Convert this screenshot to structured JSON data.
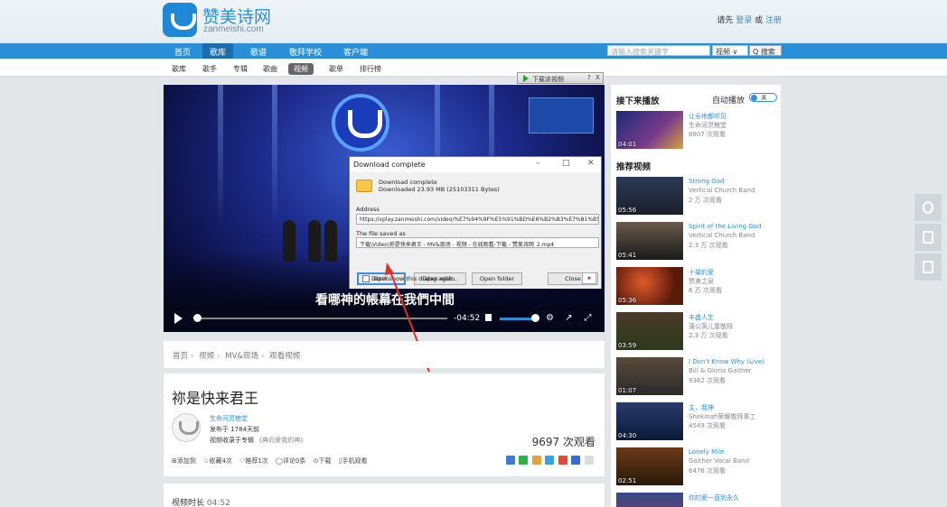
{
  "site": {
    "name": "赞美诗网",
    "domain": "zanmeishi.com"
  },
  "auth": {
    "prefix": "请先",
    "login": "登录",
    "or": "或",
    "register": "注册"
  },
  "nav": {
    "items": [
      "首页",
      "歌库",
      "歌谱",
      "敬拜学校",
      "客户端"
    ]
  },
  "search": {
    "placeholder": "请输入搜索关键字",
    "scope": "视频 ∨",
    "button": "Q 搜索"
  },
  "subnav": {
    "items": [
      "歌库",
      "歌手",
      "专辑",
      "歌曲",
      "视频",
      "歌单",
      "排行榜"
    ]
  },
  "download_bar": {
    "label": "下载该视频",
    "help": "?",
    "close": "X"
  },
  "video": {
    "subtitle": "看哪神的帳幕在我們中間",
    "time_remaining": "-04:52",
    "progress": 0.01,
    "volume": 0.85
  },
  "dialog": {
    "title": "Download complete",
    "minimize": "–",
    "maximize": "□",
    "close": "✕",
    "line1": "Download complete",
    "line2": "Downloaded 23.93  MB (25103311 Bytes)",
    "address_label": "Address",
    "address_value": "https://vplay.zanmeishi.com/video/%E7%94%9F%E5%91%BD%E6%B2%B3%E7%81%B5",
    "saved_label": "The file saved as",
    "saved_value": "下载\\Video\\祢是快来君王 - MV&现场 - 视频 - 在线观看-下载 - 赞美诗网_2.mp4",
    "btn_open": "Open",
    "btn_open_with": "Open with...",
    "btn_open_folder": "Open folder",
    "btn_close": "Close",
    "checkbox_label": "Don't show this dialog again"
  },
  "breadcrumb": {
    "items": [
      "首页",
      "视频",
      "MV&现场",
      "观看视频"
    ]
  },
  "info": {
    "title": "祢是快来君王",
    "uploader": "生命河灵粮堂",
    "published": "发布于 1784天前",
    "album_prefix": "视频收录于专辑",
    "album_name": "《典向爱我的神》",
    "views": "9697 次观看",
    "actions": [
      "⊞添加到",
      "☆收藏4次",
      "♡推荐1次",
      "◯评论0条",
      "⊙下载",
      "▯手机观看"
    ]
  },
  "duration": {
    "label": "视频时长",
    "value": "04:52"
  },
  "sidebar": {
    "next_heading": "接下来播放",
    "autoplay_label": "自动播放",
    "toggle_label": "关",
    "recommend_heading": "推荐视频",
    "next": {
      "title": "让全地都听见",
      "artist": "生命河灵粮堂",
      "views": "8807 次观看",
      "duration": "04:01"
    },
    "items": [
      {
        "title": "Strong God",
        "artist": "Vertical Church Band",
        "views": "2 万 次观看",
        "duration": "05:56"
      },
      {
        "title": "Spirit of the Living God",
        "artist": "Vertical Church Band",
        "views": "2.3 万 次观看",
        "duration": "05:41"
      },
      {
        "title": "十架的爱",
        "artist": "赞美之泉",
        "views": "6 万 次观看",
        "duration": "05:36"
      },
      {
        "title": "丰盛人生",
        "artist": "蒲公英儿童敬拜",
        "views": "2.3 万 次观看",
        "duration": "03:59"
      },
      {
        "title": "I Don't Know Why (Live)",
        "artist": "Bill & Gloria Gaither",
        "views": "9362 次观看",
        "duration": "01:07"
      },
      {
        "title": "主，我神",
        "artist": "Shekinah荣耀敬拜事工",
        "views": "4549 次观看",
        "duration": "04:30"
      },
      {
        "title": "Lonely Mile",
        "artist": "Gaither Vocal Band",
        "views": "6476 次观看",
        "duration": "02:51"
      },
      {
        "title": "你的爱一直到永久",
        "artist": "",
        "views": "",
        "duration": ""
      }
    ]
  },
  "colors": {
    "brand": "#2a8fd6",
    "link": "#2a90d8",
    "annotation_arrow": "#e0302a"
  }
}
